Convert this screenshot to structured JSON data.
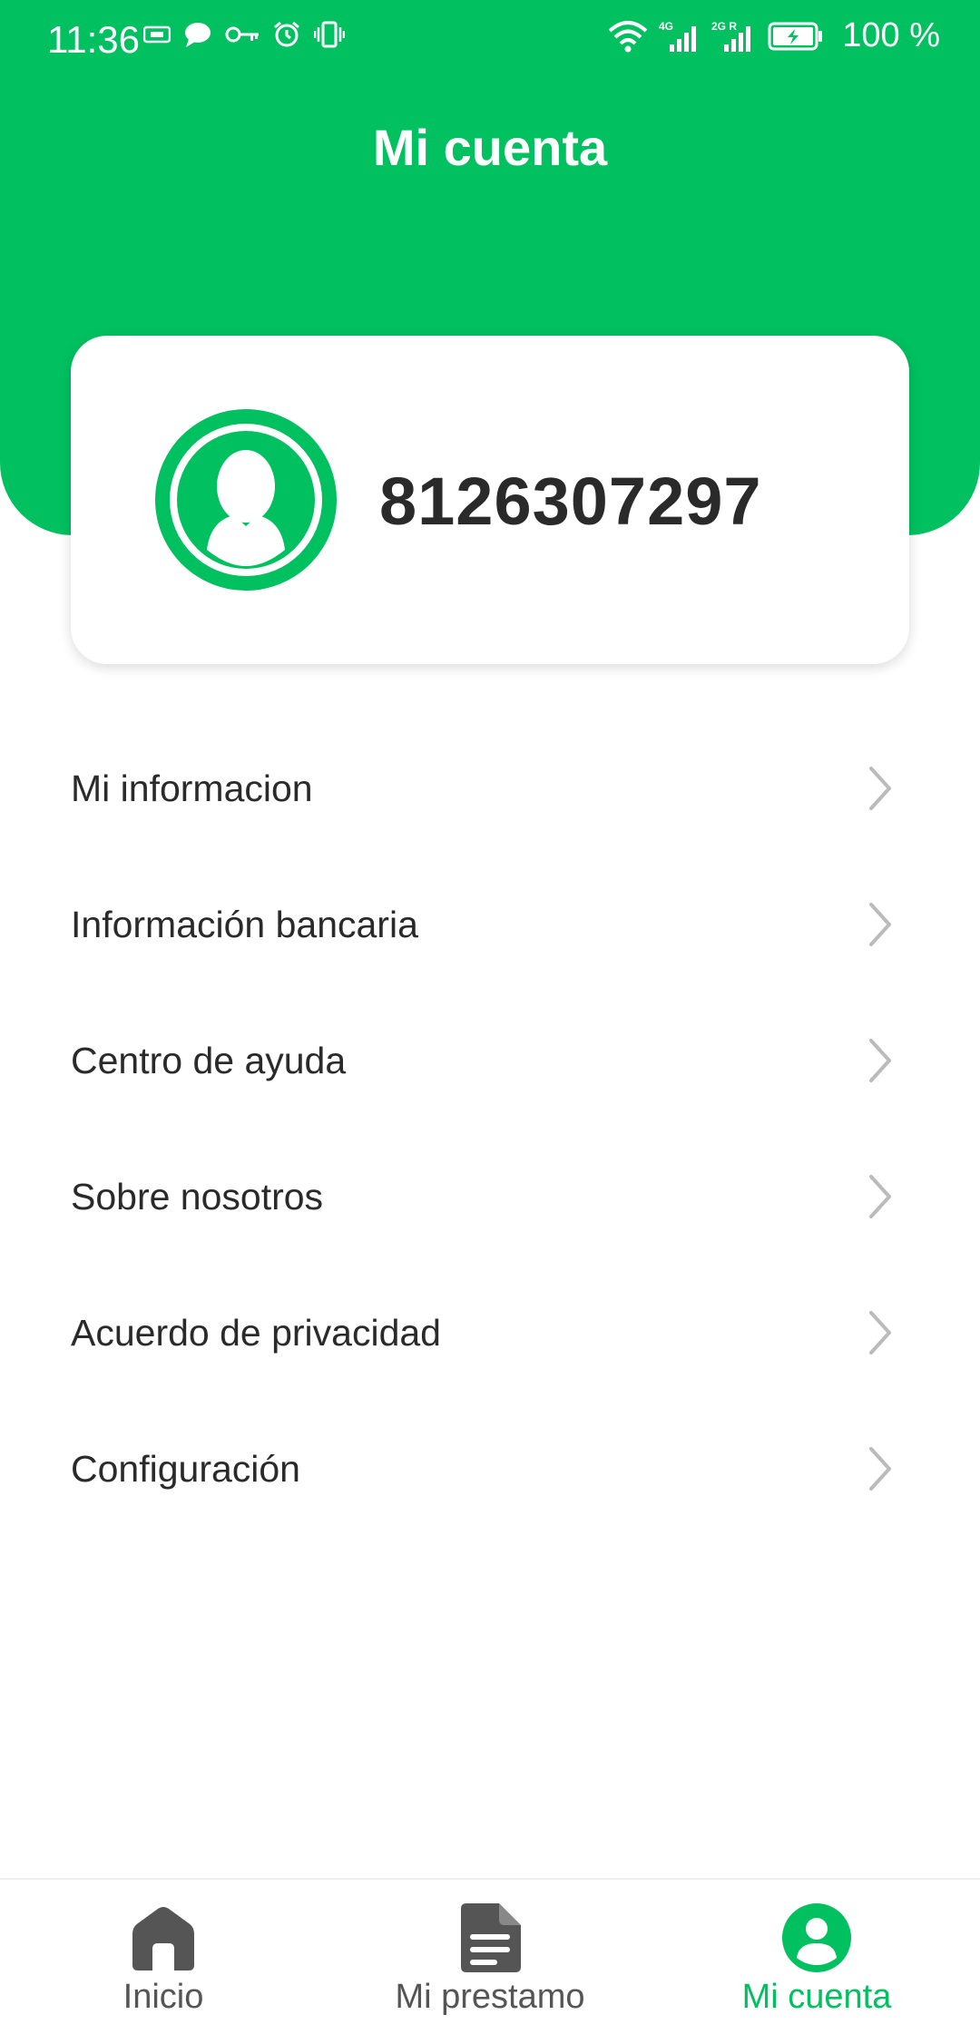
{
  "status_bar": {
    "time": "11:36",
    "network_4g": "4G",
    "network_2g": "2G R",
    "battery": "100 %"
  },
  "header": {
    "title": "Mi cuenta"
  },
  "profile": {
    "account_number": "8126307297"
  },
  "menu": {
    "items": [
      {
        "label": "Mi informacion"
      },
      {
        "label": "Información bancaria"
      },
      {
        "label": "Centro de ayuda"
      },
      {
        "label": "Sobre nosotros"
      },
      {
        "label": "Acuerdo de privacidad"
      },
      {
        "label": "Configuración"
      }
    ]
  },
  "tabbar": {
    "tabs": [
      {
        "label": "Inicio",
        "icon": "home-icon",
        "active": false
      },
      {
        "label": "Mi prestamo",
        "icon": "document-icon",
        "active": false
      },
      {
        "label": "Mi cuenta",
        "icon": "user-icon",
        "active": true
      }
    ]
  },
  "colors": {
    "brand_green": "#00c060",
    "inactive_icon": "#555555",
    "chevron": "#bbbbbb"
  }
}
